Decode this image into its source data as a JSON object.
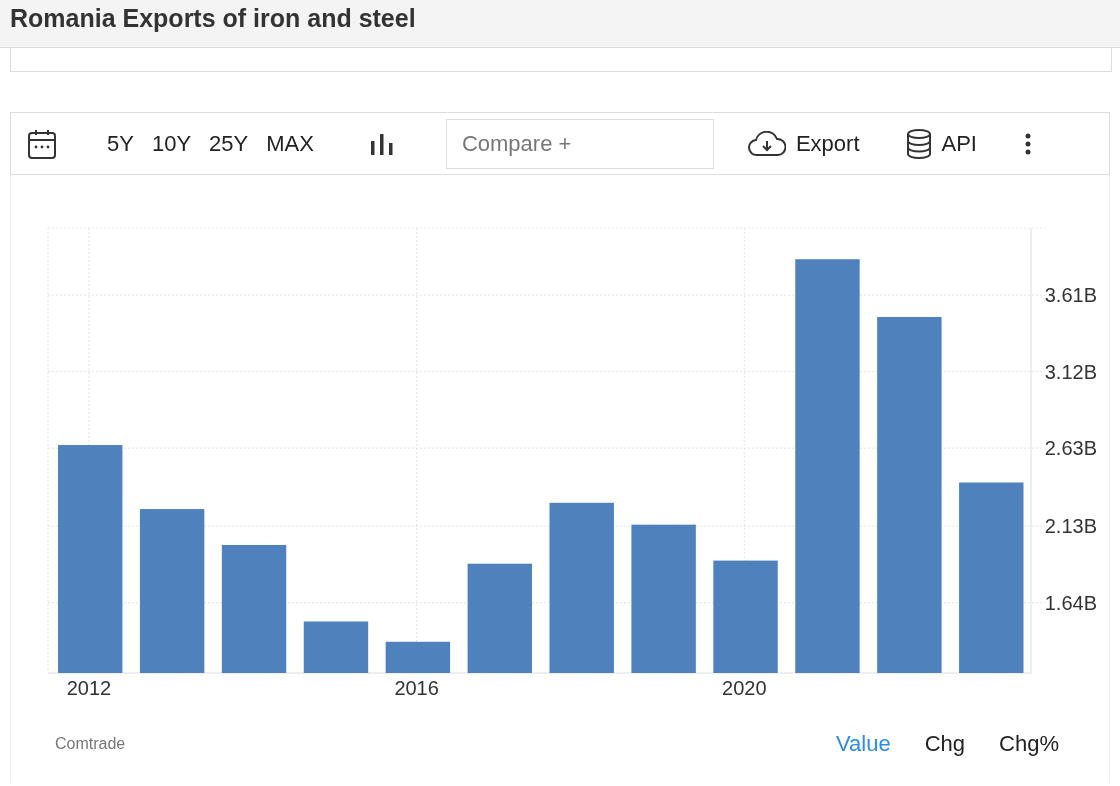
{
  "page": {
    "title": "Romania Exports of iron and steel"
  },
  "toolbar": {
    "ranges": [
      {
        "label": "5Y",
        "selected": false
      },
      {
        "label": "10Y",
        "selected": false
      },
      {
        "label": "25Y",
        "selected": false
      },
      {
        "label": "MAX",
        "selected": false
      }
    ],
    "compare": {
      "placeholder": "Compare +"
    },
    "export": "Export",
    "api": "API"
  },
  "chart": {
    "chart_data": {
      "type": "bar",
      "x": [
        2012,
        2013,
        2014,
        2015,
        2016,
        2017,
        2018,
        2019,
        2020,
        2021,
        2022,
        2023
      ],
      "series": [
        {
          "color": "#4f81bd",
          "values": [
            2.65,
            2.24,
            2.01,
            1.52,
            1.39,
            1.89,
            2.28,
            2.14,
            1.91,
            3.84,
            3.47,
            2.41
          ]
        }
      ],
      "xlim": [
        2011.5,
        2023.5
      ],
      "xticks": [
        2012,
        2016,
        2020
      ],
      "grid": true,
      "ylim": [
        1.19,
        4.04
      ],
      "yticks": [
        {
          "value": 1.64,
          "label": "1.64B"
        },
        {
          "value": 2.13,
          "label": "2.13B"
        },
        {
          "value": 2.63,
          "label": "2.63B"
        },
        {
          "value": 3.12,
          "label": "3.12B"
        },
        {
          "value": 3.61,
          "label": "3.61B"
        }
      ]
    }
  },
  "footer": {
    "source": "Comtrade",
    "views": [
      {
        "label": "Value",
        "selected": true
      },
      {
        "label": "Chg",
        "selected": false
      },
      {
        "label": "Chg%",
        "selected": false
      }
    ]
  }
}
